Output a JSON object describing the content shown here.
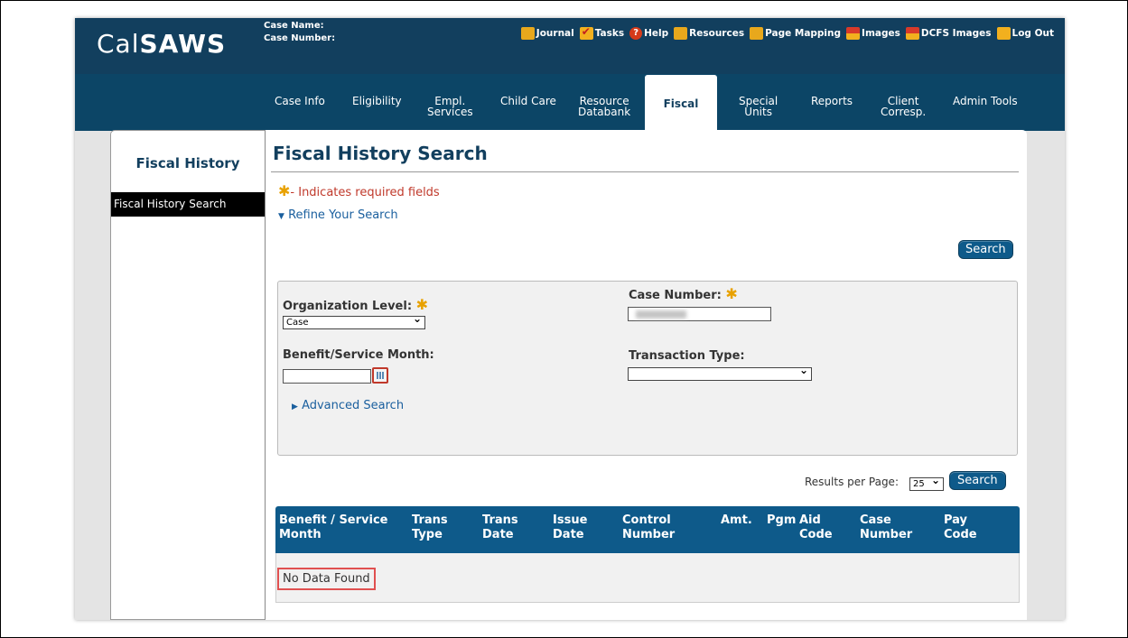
{
  "header": {
    "logo_prefix": "Cal",
    "logo_bold": "SAWS",
    "case_name_label": "Case Name:",
    "case_number_label": "Case Number:",
    "utilities": [
      {
        "label": "Journal",
        "icon": "journal-icon"
      },
      {
        "label": "Tasks",
        "icon": "tasks-icon"
      },
      {
        "label": "Help",
        "icon": "help-icon"
      },
      {
        "label": "Resources",
        "icon": "resources-icon"
      },
      {
        "label": "Page Mapping",
        "icon": "page-mapping-icon"
      },
      {
        "label": "Images",
        "icon": "images-icon"
      },
      {
        "label": "DCFS Images",
        "icon": "dcfs-images-icon"
      },
      {
        "label": "Log Out",
        "icon": "logout-icon"
      }
    ]
  },
  "nav": {
    "items": [
      {
        "line1": "Case Info",
        "line2": ""
      },
      {
        "line1": "Eligibility",
        "line2": ""
      },
      {
        "line1": "Empl.",
        "line2": "Services"
      },
      {
        "line1": "Child Care",
        "line2": ""
      },
      {
        "line1": "Resource",
        "line2": "Databank"
      },
      {
        "line1": "Fiscal",
        "line2": ""
      },
      {
        "line1": "Special",
        "line2": "Units"
      },
      {
        "line1": "Reports",
        "line2": ""
      },
      {
        "line1": "Client",
        "line2": "Corresp."
      },
      {
        "line1": "Admin Tools",
        "line2": ""
      }
    ],
    "active": "Fiscal"
  },
  "sidebar": {
    "title": "Fiscal History",
    "items": [
      {
        "label": "Fiscal History Search"
      }
    ]
  },
  "main": {
    "title": "Fiscal History Search",
    "required_star": "✱",
    "required_text": "- Indicates required fields",
    "refine_arrow": "▼",
    "refine_text": "Refine Your Search",
    "search_button": "Search",
    "form": {
      "org_level_label": "Organization Level:",
      "org_level_value": "Case",
      "case_number_label": "Case Number:",
      "benefit_month_label": "Benefit/Service Month:",
      "transaction_type_label": "Transaction Type:",
      "transaction_type_value": "",
      "advanced_arrow": "▶",
      "advanced_text": "Advanced Search"
    },
    "results_per_page_label": "Results per Page:",
    "results_per_page_value": "25",
    "results_search_button": "Search",
    "table": {
      "columns": [
        {
          "line1": "Benefit / Service",
          "line2": "Month"
        },
        {
          "line1": "Trans",
          "line2": "Type"
        },
        {
          "line1": "Trans",
          "line2": "Date"
        },
        {
          "line1": "Issue",
          "line2": "Date"
        },
        {
          "line1": "Control",
          "line2": "Number"
        },
        {
          "line1": "Amt.",
          "line2": ""
        },
        {
          "line1": "Pgm",
          "line2": ""
        },
        {
          "line1": "Aid",
          "line2": "Code"
        },
        {
          "line1": "Case",
          "line2": "Number"
        },
        {
          "line1": "Pay",
          "line2": "Code"
        }
      ],
      "empty_text": "No Data Found"
    }
  }
}
